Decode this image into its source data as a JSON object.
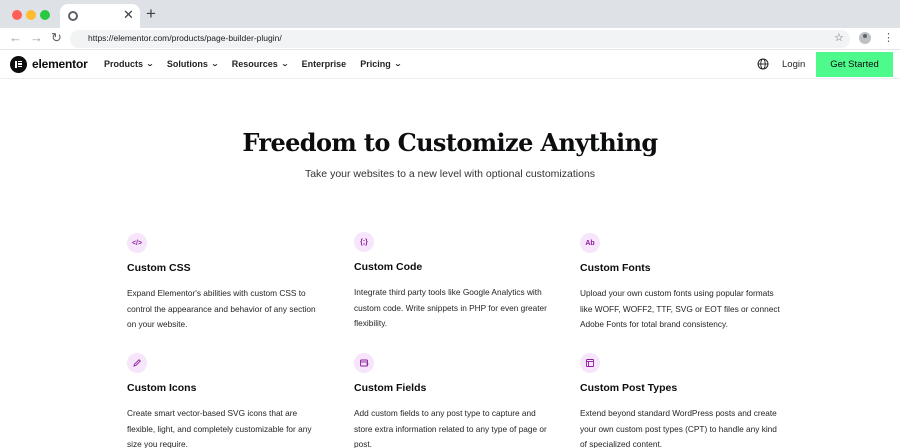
{
  "browser": {
    "url": "https://elementor.com/products/page-builder-plugin/"
  },
  "header": {
    "logo_text": "elementor",
    "nav": [
      {
        "label": "Products",
        "has_dropdown": true
      },
      {
        "label": "Solutions",
        "has_dropdown": true
      },
      {
        "label": "Resources",
        "has_dropdown": true
      },
      {
        "label": "Enterprise",
        "has_dropdown": false
      },
      {
        "label": "Pricing",
        "has_dropdown": true
      }
    ],
    "login_label": "Login",
    "cta_label": "Get Started"
  },
  "hero": {
    "title": "Freedom to Customize Anything",
    "subtitle": "Take your websites to a new level with optional customizations"
  },
  "features": [
    {
      "icon": "code-icon",
      "glyph": "</>",
      "title": "Custom CSS",
      "description": "Expand Elementor's abilities with custom CSS to control the appearance and behavior of any section on your website."
    },
    {
      "icon": "braces-icon",
      "glyph": "{;}",
      "title": "Custom Code",
      "description": "Integrate third party tools like Google Analytics with custom code. Write snippets in PHP for even greater flexibility."
    },
    {
      "icon": "font-icon",
      "glyph": "Ab",
      "title": "Custom Fonts",
      "description": "Upload your own custom fonts using popular formats like WOFF, WOFF2, TTF, SVG or EOT files or connect Adobe Fonts for total brand consistency."
    },
    {
      "icon": "pencil-icon",
      "glyph": "",
      "title": "Custom Icons",
      "description": "Create smart vector-based SVG icons that are flexible, light, and completely customizable for any size you require."
    },
    {
      "icon": "form-field-icon",
      "glyph": "",
      "title": "Custom Fields",
      "description": "Add custom fields to any post type to capture and store extra information related to any type of page or post."
    },
    {
      "icon": "post-type-icon",
      "glyph": "",
      "title": "Custom Post Types",
      "description": "Extend beyond standard WordPress posts and create your own custom post types (CPT) to handle any kind of specialized content."
    }
  ],
  "colors": {
    "cta_green": "#4efa8c",
    "icon_bg": "#f7e5fb",
    "icon_accent": "#8b1e9b",
    "text_dark": "#0c0d0e"
  }
}
